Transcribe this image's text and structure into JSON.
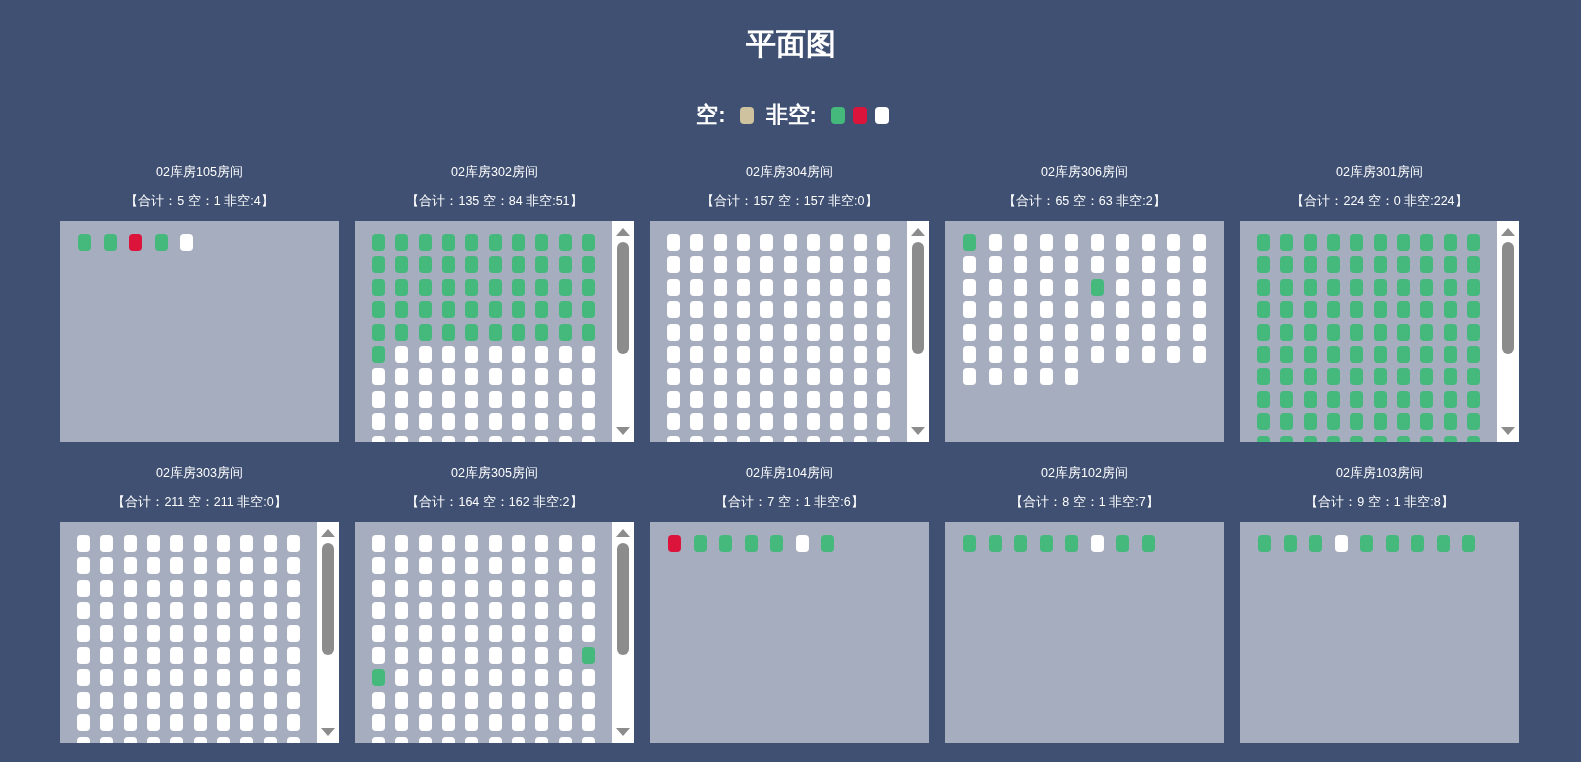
{
  "title": "平面图",
  "legend": [
    {
      "label": "空:",
      "swatches": [
        {
          "color": "#cfc29f"
        }
      ]
    },
    {
      "label": "非空:",
      "swatches": [
        {
          "color": "#45b97c"
        },
        {
          "color": "#dc143c"
        },
        {
          "color": "#ffffff"
        }
      ]
    }
  ],
  "rooms": [
    {
      "name": "02库房105房间",
      "summary": "【合计：5 空：1 非空:4】",
      "scrollable": false,
      "rows": [
        [
          {
            "color": "#45b97c"
          },
          {
            "color": "#45b97c"
          },
          {
            "color": "#dc143c"
          },
          {
            "color": "#45b97c"
          },
          {
            "color": "#ffffff"
          }
        ]
      ]
    },
    {
      "name": "02库房302房间",
      "summary": "【合计：135 空：84 非空:51】",
      "scrollable": true,
      "rows": [
        [
          {
            "color": "#45b97c"
          },
          {
            "color": "#45b97c"
          },
          {
            "color": "#45b97c"
          },
          {
            "color": "#45b97c"
          },
          {
            "color": "#45b97c"
          },
          {
            "color": "#45b97c"
          },
          {
            "color": "#45b97c"
          },
          {
            "color": "#45b97c"
          },
          {
            "color": "#45b97c"
          },
          {
            "color": "#45b97c"
          }
        ],
        [
          {
            "color": "#45b97c"
          },
          {
            "color": "#45b97c"
          },
          {
            "color": "#45b97c"
          },
          {
            "color": "#45b97c"
          },
          {
            "color": "#45b97c"
          },
          {
            "color": "#45b97c"
          },
          {
            "color": "#45b97c"
          },
          {
            "color": "#45b97c"
          },
          {
            "color": "#45b97c"
          },
          {
            "color": "#45b97c"
          }
        ],
        [
          {
            "color": "#45b97c"
          },
          {
            "color": "#45b97c"
          },
          {
            "color": "#45b97c"
          },
          {
            "color": "#45b97c"
          },
          {
            "color": "#45b97c"
          },
          {
            "color": "#45b97c"
          },
          {
            "color": "#45b97c"
          },
          {
            "color": "#45b97c"
          },
          {
            "color": "#45b97c"
          },
          {
            "color": "#45b97c"
          }
        ],
        [
          {
            "color": "#45b97c"
          },
          {
            "color": "#45b97c"
          },
          {
            "color": "#45b97c"
          },
          {
            "color": "#45b97c"
          },
          {
            "color": "#45b97c"
          },
          {
            "color": "#45b97c"
          },
          {
            "color": "#45b97c"
          },
          {
            "color": "#45b97c"
          },
          {
            "color": "#45b97c"
          },
          {
            "color": "#45b97c"
          }
        ],
        [
          {
            "color": "#45b97c"
          },
          {
            "color": "#45b97c"
          },
          {
            "color": "#45b97c"
          },
          {
            "color": "#45b97c"
          },
          {
            "color": "#45b97c"
          },
          {
            "color": "#45b97c"
          },
          {
            "color": "#45b97c"
          },
          {
            "color": "#45b97c"
          },
          {
            "color": "#45b97c"
          },
          {
            "color": "#45b97c"
          }
        ],
        [
          {
            "color": "#45b97c"
          },
          {
            "color": "#ffffff"
          },
          {
            "color": "#ffffff"
          },
          {
            "color": "#ffffff"
          },
          {
            "color": "#ffffff"
          },
          {
            "color": "#ffffff"
          },
          {
            "color": "#ffffff"
          },
          {
            "color": "#ffffff"
          },
          {
            "color": "#ffffff"
          },
          {
            "color": "#ffffff"
          }
        ],
        [
          {
            "color": "#ffffff"
          },
          {
            "color": "#ffffff"
          },
          {
            "color": "#ffffff"
          },
          {
            "color": "#ffffff"
          },
          {
            "color": "#ffffff"
          },
          {
            "color": "#ffffff"
          },
          {
            "color": "#ffffff"
          },
          {
            "color": "#ffffff"
          },
          {
            "color": "#ffffff"
          },
          {
            "color": "#ffffff"
          }
        ],
        [
          {
            "color": "#ffffff"
          },
          {
            "color": "#ffffff"
          },
          {
            "color": "#ffffff"
          },
          {
            "color": "#ffffff"
          },
          {
            "color": "#ffffff"
          },
          {
            "color": "#ffffff"
          },
          {
            "color": "#ffffff"
          },
          {
            "color": "#ffffff"
          },
          {
            "color": "#ffffff"
          },
          {
            "color": "#ffffff"
          }
        ],
        [
          {
            "color": "#ffffff"
          },
          {
            "color": "#ffffff"
          },
          {
            "color": "#ffffff"
          },
          {
            "color": "#ffffff"
          },
          {
            "color": "#ffffff"
          },
          {
            "color": "#ffffff"
          },
          {
            "color": "#ffffff"
          },
          {
            "color": "#ffffff"
          },
          {
            "color": "#ffffff"
          },
          {
            "color": "#ffffff"
          }
        ],
        [
          {
            "color": "#ffffff"
          },
          {
            "color": "#ffffff"
          },
          {
            "color": "#ffffff"
          },
          {
            "color": "#ffffff"
          },
          {
            "color": "#ffffff"
          },
          {
            "color": "#ffffff"
          },
          {
            "color": "#ffffff"
          },
          {
            "color": "#ffffff"
          },
          {
            "color": "#ffffff"
          },
          {
            "color": "#ffffff"
          }
        ]
      ]
    },
    {
      "name": "02库房304房间",
      "summary": "【合计：157 空：157 非空:0】",
      "scrollable": true,
      "rows": [
        [
          {
            "color": "#ffffff"
          },
          {
            "color": "#ffffff"
          },
          {
            "color": "#ffffff"
          },
          {
            "color": "#ffffff"
          },
          {
            "color": "#ffffff"
          },
          {
            "color": "#ffffff"
          },
          {
            "color": "#ffffff"
          },
          {
            "color": "#ffffff"
          },
          {
            "color": "#ffffff"
          },
          {
            "color": "#ffffff"
          }
        ],
        [
          {
            "color": "#ffffff"
          },
          {
            "color": "#ffffff"
          },
          {
            "color": "#ffffff"
          },
          {
            "color": "#ffffff"
          },
          {
            "color": "#ffffff"
          },
          {
            "color": "#ffffff"
          },
          {
            "color": "#ffffff"
          },
          {
            "color": "#ffffff"
          },
          {
            "color": "#ffffff"
          },
          {
            "color": "#ffffff"
          }
        ],
        [
          {
            "color": "#ffffff"
          },
          {
            "color": "#ffffff"
          },
          {
            "color": "#ffffff"
          },
          {
            "color": "#ffffff"
          },
          {
            "color": "#ffffff"
          },
          {
            "color": "#ffffff"
          },
          {
            "color": "#ffffff"
          },
          {
            "color": "#ffffff"
          },
          {
            "color": "#ffffff"
          },
          {
            "color": "#ffffff"
          }
        ],
        [
          {
            "color": "#ffffff"
          },
          {
            "color": "#ffffff"
          },
          {
            "color": "#ffffff"
          },
          {
            "color": "#ffffff"
          },
          {
            "color": "#ffffff"
          },
          {
            "color": "#ffffff"
          },
          {
            "color": "#ffffff"
          },
          {
            "color": "#ffffff"
          },
          {
            "color": "#ffffff"
          },
          {
            "color": "#ffffff"
          }
        ],
        [
          {
            "color": "#ffffff"
          },
          {
            "color": "#ffffff"
          },
          {
            "color": "#ffffff"
          },
          {
            "color": "#ffffff"
          },
          {
            "color": "#ffffff"
          },
          {
            "color": "#ffffff"
          },
          {
            "color": "#ffffff"
          },
          {
            "color": "#ffffff"
          },
          {
            "color": "#ffffff"
          },
          {
            "color": "#ffffff"
          }
        ],
        [
          {
            "color": "#ffffff"
          },
          {
            "color": "#ffffff"
          },
          {
            "color": "#ffffff"
          },
          {
            "color": "#ffffff"
          },
          {
            "color": "#ffffff"
          },
          {
            "color": "#ffffff"
          },
          {
            "color": "#ffffff"
          },
          {
            "color": "#ffffff"
          },
          {
            "color": "#ffffff"
          },
          {
            "color": "#ffffff"
          }
        ],
        [
          {
            "color": "#ffffff"
          },
          {
            "color": "#ffffff"
          },
          {
            "color": "#ffffff"
          },
          {
            "color": "#ffffff"
          },
          {
            "color": "#ffffff"
          },
          {
            "color": "#ffffff"
          },
          {
            "color": "#ffffff"
          },
          {
            "color": "#ffffff"
          },
          {
            "color": "#ffffff"
          },
          {
            "color": "#ffffff"
          }
        ],
        [
          {
            "color": "#ffffff"
          },
          {
            "color": "#ffffff"
          },
          {
            "color": "#ffffff"
          },
          {
            "color": "#ffffff"
          },
          {
            "color": "#ffffff"
          },
          {
            "color": "#ffffff"
          },
          {
            "color": "#ffffff"
          },
          {
            "color": "#ffffff"
          },
          {
            "color": "#ffffff"
          },
          {
            "color": "#ffffff"
          }
        ],
        [
          {
            "color": "#ffffff"
          },
          {
            "color": "#ffffff"
          },
          {
            "color": "#ffffff"
          },
          {
            "color": "#ffffff"
          },
          {
            "color": "#ffffff"
          },
          {
            "color": "#ffffff"
          },
          {
            "color": "#ffffff"
          },
          {
            "color": "#ffffff"
          },
          {
            "color": "#ffffff"
          },
          {
            "color": "#ffffff"
          }
        ],
        [
          {
            "color": "#ffffff"
          },
          {
            "color": "#ffffff"
          },
          {
            "color": "#ffffff"
          },
          {
            "color": "#ffffff"
          },
          {
            "color": "#ffffff"
          },
          {
            "color": "#ffffff"
          },
          {
            "color": "#ffffff"
          },
          {
            "color": "#ffffff"
          },
          {
            "color": "#ffffff"
          },
          {
            "color": "#ffffff"
          }
        ]
      ]
    },
    {
      "name": "02库房306房间",
      "summary": "【合计：65 空：63 非空:2】",
      "scrollable": false,
      "rows": [
        [
          {
            "color": "#45b97c"
          },
          {
            "color": "#ffffff"
          },
          {
            "color": "#ffffff"
          },
          {
            "color": "#ffffff"
          },
          {
            "color": "#ffffff"
          },
          {
            "color": "#ffffff"
          },
          {
            "color": "#ffffff"
          },
          {
            "color": "#ffffff"
          },
          {
            "color": "#ffffff"
          },
          {
            "color": "#ffffff"
          }
        ],
        [
          {
            "color": "#ffffff"
          },
          {
            "color": "#ffffff"
          },
          {
            "color": "#ffffff"
          },
          {
            "color": "#ffffff"
          },
          {
            "color": "#ffffff"
          },
          {
            "color": "#ffffff"
          },
          {
            "color": "#ffffff"
          },
          {
            "color": "#ffffff"
          },
          {
            "color": "#ffffff"
          },
          {
            "color": "#ffffff"
          }
        ],
        [
          {
            "color": "#ffffff"
          },
          {
            "color": "#ffffff"
          },
          {
            "color": "#ffffff"
          },
          {
            "color": "#ffffff"
          },
          {
            "color": "#ffffff"
          },
          {
            "color": "#45b97c"
          },
          {
            "color": "#ffffff"
          },
          {
            "color": "#ffffff"
          },
          {
            "color": "#ffffff"
          },
          {
            "color": "#ffffff"
          }
        ],
        [
          {
            "color": "#ffffff"
          },
          {
            "color": "#ffffff"
          },
          {
            "color": "#ffffff"
          },
          {
            "color": "#ffffff"
          },
          {
            "color": "#ffffff"
          },
          {
            "color": "#ffffff"
          },
          {
            "color": "#ffffff"
          },
          {
            "color": "#ffffff"
          },
          {
            "color": "#ffffff"
          },
          {
            "color": "#ffffff"
          }
        ],
        [
          {
            "color": "#ffffff"
          },
          {
            "color": "#ffffff"
          },
          {
            "color": "#ffffff"
          },
          {
            "color": "#ffffff"
          },
          {
            "color": "#ffffff"
          },
          {
            "color": "#ffffff"
          },
          {
            "color": "#ffffff"
          },
          {
            "color": "#ffffff"
          },
          {
            "color": "#ffffff"
          },
          {
            "color": "#ffffff"
          }
        ],
        [
          {
            "color": "#ffffff"
          },
          {
            "color": "#ffffff"
          },
          {
            "color": "#ffffff"
          },
          {
            "color": "#ffffff"
          },
          {
            "color": "#ffffff"
          },
          {
            "color": "#ffffff"
          },
          {
            "color": "#ffffff"
          },
          {
            "color": "#ffffff"
          },
          {
            "color": "#ffffff"
          },
          {
            "color": "#ffffff"
          }
        ],
        [
          {
            "color": "#ffffff"
          },
          {
            "color": "#ffffff"
          },
          {
            "color": "#ffffff"
          },
          {
            "color": "#ffffff"
          },
          {
            "color": "#ffffff"
          }
        ]
      ]
    },
    {
      "name": "02库房301房间",
      "summary": "【合计：224 空：0 非空:224】",
      "scrollable": true,
      "rows": [
        [
          {
            "color": "#45b97c"
          },
          {
            "color": "#45b97c"
          },
          {
            "color": "#45b97c"
          },
          {
            "color": "#45b97c"
          },
          {
            "color": "#45b97c"
          },
          {
            "color": "#45b97c"
          },
          {
            "color": "#45b97c"
          },
          {
            "color": "#45b97c"
          },
          {
            "color": "#45b97c"
          },
          {
            "color": "#45b97c"
          }
        ],
        [
          {
            "color": "#45b97c"
          },
          {
            "color": "#45b97c"
          },
          {
            "color": "#45b97c"
          },
          {
            "color": "#45b97c"
          },
          {
            "color": "#45b97c"
          },
          {
            "color": "#45b97c"
          },
          {
            "color": "#45b97c"
          },
          {
            "color": "#45b97c"
          },
          {
            "color": "#45b97c"
          },
          {
            "color": "#45b97c"
          }
        ],
        [
          {
            "color": "#45b97c"
          },
          {
            "color": "#45b97c"
          },
          {
            "color": "#45b97c"
          },
          {
            "color": "#45b97c"
          },
          {
            "color": "#45b97c"
          },
          {
            "color": "#45b97c"
          },
          {
            "color": "#45b97c"
          },
          {
            "color": "#45b97c"
          },
          {
            "color": "#45b97c"
          },
          {
            "color": "#45b97c"
          }
        ],
        [
          {
            "color": "#45b97c"
          },
          {
            "color": "#45b97c"
          },
          {
            "color": "#45b97c"
          },
          {
            "color": "#45b97c"
          },
          {
            "color": "#45b97c"
          },
          {
            "color": "#45b97c"
          },
          {
            "color": "#45b97c"
          },
          {
            "color": "#45b97c"
          },
          {
            "color": "#45b97c"
          },
          {
            "color": "#45b97c"
          }
        ],
        [
          {
            "color": "#45b97c"
          },
          {
            "color": "#45b97c"
          },
          {
            "color": "#45b97c"
          },
          {
            "color": "#45b97c"
          },
          {
            "color": "#45b97c"
          },
          {
            "color": "#45b97c"
          },
          {
            "color": "#45b97c"
          },
          {
            "color": "#45b97c"
          },
          {
            "color": "#45b97c"
          },
          {
            "color": "#45b97c"
          }
        ],
        [
          {
            "color": "#45b97c"
          },
          {
            "color": "#45b97c"
          },
          {
            "color": "#45b97c"
          },
          {
            "color": "#45b97c"
          },
          {
            "color": "#45b97c"
          },
          {
            "color": "#45b97c"
          },
          {
            "color": "#45b97c"
          },
          {
            "color": "#45b97c"
          },
          {
            "color": "#45b97c"
          },
          {
            "color": "#45b97c"
          }
        ],
        [
          {
            "color": "#45b97c"
          },
          {
            "color": "#45b97c"
          },
          {
            "color": "#45b97c"
          },
          {
            "color": "#45b97c"
          },
          {
            "color": "#45b97c"
          },
          {
            "color": "#45b97c"
          },
          {
            "color": "#45b97c"
          },
          {
            "color": "#45b97c"
          },
          {
            "color": "#45b97c"
          },
          {
            "color": "#45b97c"
          }
        ],
        [
          {
            "color": "#45b97c"
          },
          {
            "color": "#45b97c"
          },
          {
            "color": "#45b97c"
          },
          {
            "color": "#45b97c"
          },
          {
            "color": "#45b97c"
          },
          {
            "color": "#45b97c"
          },
          {
            "color": "#45b97c"
          },
          {
            "color": "#45b97c"
          },
          {
            "color": "#45b97c"
          },
          {
            "color": "#45b97c"
          }
        ],
        [
          {
            "color": "#45b97c"
          },
          {
            "color": "#45b97c"
          },
          {
            "color": "#45b97c"
          },
          {
            "color": "#45b97c"
          },
          {
            "color": "#45b97c"
          },
          {
            "color": "#45b97c"
          },
          {
            "color": "#45b97c"
          },
          {
            "color": "#45b97c"
          },
          {
            "color": "#45b97c"
          },
          {
            "color": "#45b97c"
          }
        ],
        [
          {
            "color": "#45b97c"
          },
          {
            "color": "#45b97c"
          },
          {
            "color": "#45b97c"
          },
          {
            "color": "#45b97c"
          },
          {
            "color": "#45b97c"
          },
          {
            "color": "#45b97c"
          },
          {
            "color": "#45b97c"
          },
          {
            "color": "#45b97c"
          },
          {
            "color": "#45b97c"
          },
          {
            "color": "#45b97c"
          }
        ]
      ]
    },
    {
      "name": "02库房303房间",
      "summary": "【合计：211 空：211 非空:0】",
      "scrollable": true,
      "rows": [
        [
          {
            "color": "#ffffff"
          },
          {
            "color": "#ffffff"
          },
          {
            "color": "#ffffff"
          },
          {
            "color": "#ffffff"
          },
          {
            "color": "#ffffff"
          },
          {
            "color": "#ffffff"
          },
          {
            "color": "#ffffff"
          },
          {
            "color": "#ffffff"
          },
          {
            "color": "#ffffff"
          },
          {
            "color": "#ffffff"
          }
        ],
        [
          {
            "color": "#ffffff"
          },
          {
            "color": "#ffffff"
          },
          {
            "color": "#ffffff"
          },
          {
            "color": "#ffffff"
          },
          {
            "color": "#ffffff"
          },
          {
            "color": "#ffffff"
          },
          {
            "color": "#ffffff"
          },
          {
            "color": "#ffffff"
          },
          {
            "color": "#ffffff"
          },
          {
            "color": "#ffffff"
          }
        ],
        [
          {
            "color": "#ffffff"
          },
          {
            "color": "#ffffff"
          },
          {
            "color": "#ffffff"
          },
          {
            "color": "#ffffff"
          },
          {
            "color": "#ffffff"
          },
          {
            "color": "#ffffff"
          },
          {
            "color": "#ffffff"
          },
          {
            "color": "#ffffff"
          },
          {
            "color": "#ffffff"
          },
          {
            "color": "#ffffff"
          }
        ],
        [
          {
            "color": "#ffffff"
          },
          {
            "color": "#ffffff"
          },
          {
            "color": "#ffffff"
          },
          {
            "color": "#ffffff"
          },
          {
            "color": "#ffffff"
          },
          {
            "color": "#ffffff"
          },
          {
            "color": "#ffffff"
          },
          {
            "color": "#ffffff"
          },
          {
            "color": "#ffffff"
          },
          {
            "color": "#ffffff"
          }
        ],
        [
          {
            "color": "#ffffff"
          },
          {
            "color": "#ffffff"
          },
          {
            "color": "#ffffff"
          },
          {
            "color": "#ffffff"
          },
          {
            "color": "#ffffff"
          },
          {
            "color": "#ffffff"
          },
          {
            "color": "#ffffff"
          },
          {
            "color": "#ffffff"
          },
          {
            "color": "#ffffff"
          },
          {
            "color": "#ffffff"
          }
        ],
        [
          {
            "color": "#ffffff"
          },
          {
            "color": "#ffffff"
          },
          {
            "color": "#ffffff"
          },
          {
            "color": "#ffffff"
          },
          {
            "color": "#ffffff"
          },
          {
            "color": "#ffffff"
          },
          {
            "color": "#ffffff"
          },
          {
            "color": "#ffffff"
          },
          {
            "color": "#ffffff"
          },
          {
            "color": "#ffffff"
          }
        ],
        [
          {
            "color": "#ffffff"
          },
          {
            "color": "#ffffff"
          },
          {
            "color": "#ffffff"
          },
          {
            "color": "#ffffff"
          },
          {
            "color": "#ffffff"
          },
          {
            "color": "#ffffff"
          },
          {
            "color": "#ffffff"
          },
          {
            "color": "#ffffff"
          },
          {
            "color": "#ffffff"
          },
          {
            "color": "#ffffff"
          }
        ],
        [
          {
            "color": "#ffffff"
          },
          {
            "color": "#ffffff"
          },
          {
            "color": "#ffffff"
          },
          {
            "color": "#ffffff"
          },
          {
            "color": "#ffffff"
          },
          {
            "color": "#ffffff"
          },
          {
            "color": "#ffffff"
          },
          {
            "color": "#ffffff"
          },
          {
            "color": "#ffffff"
          },
          {
            "color": "#ffffff"
          }
        ],
        [
          {
            "color": "#ffffff"
          },
          {
            "color": "#ffffff"
          },
          {
            "color": "#ffffff"
          },
          {
            "color": "#ffffff"
          },
          {
            "color": "#ffffff"
          },
          {
            "color": "#ffffff"
          },
          {
            "color": "#ffffff"
          },
          {
            "color": "#ffffff"
          },
          {
            "color": "#ffffff"
          },
          {
            "color": "#ffffff"
          }
        ],
        [
          {
            "color": "#ffffff"
          },
          {
            "color": "#ffffff"
          },
          {
            "color": "#ffffff"
          },
          {
            "color": "#ffffff"
          },
          {
            "color": "#ffffff"
          },
          {
            "color": "#ffffff"
          },
          {
            "color": "#ffffff"
          },
          {
            "color": "#ffffff"
          },
          {
            "color": "#ffffff"
          },
          {
            "color": "#ffffff"
          }
        ]
      ]
    },
    {
      "name": "02库房305房间",
      "summary": "【合计：164 空：162 非空:2】",
      "scrollable": true,
      "rows": [
        [
          {
            "color": "#ffffff"
          },
          {
            "color": "#ffffff"
          },
          {
            "color": "#ffffff"
          },
          {
            "color": "#ffffff"
          },
          {
            "color": "#ffffff"
          },
          {
            "color": "#ffffff"
          },
          {
            "color": "#ffffff"
          },
          {
            "color": "#ffffff"
          },
          {
            "color": "#ffffff"
          },
          {
            "color": "#ffffff"
          }
        ],
        [
          {
            "color": "#ffffff"
          },
          {
            "color": "#ffffff"
          },
          {
            "color": "#ffffff"
          },
          {
            "color": "#ffffff"
          },
          {
            "color": "#ffffff"
          },
          {
            "color": "#ffffff"
          },
          {
            "color": "#ffffff"
          },
          {
            "color": "#ffffff"
          },
          {
            "color": "#ffffff"
          },
          {
            "color": "#ffffff"
          }
        ],
        [
          {
            "color": "#ffffff"
          },
          {
            "color": "#ffffff"
          },
          {
            "color": "#ffffff"
          },
          {
            "color": "#ffffff"
          },
          {
            "color": "#ffffff"
          },
          {
            "color": "#ffffff"
          },
          {
            "color": "#ffffff"
          },
          {
            "color": "#ffffff"
          },
          {
            "color": "#ffffff"
          },
          {
            "color": "#ffffff"
          }
        ],
        [
          {
            "color": "#ffffff"
          },
          {
            "color": "#ffffff"
          },
          {
            "color": "#ffffff"
          },
          {
            "color": "#ffffff"
          },
          {
            "color": "#ffffff"
          },
          {
            "color": "#ffffff"
          },
          {
            "color": "#ffffff"
          },
          {
            "color": "#ffffff"
          },
          {
            "color": "#ffffff"
          },
          {
            "color": "#ffffff"
          }
        ],
        [
          {
            "color": "#ffffff"
          },
          {
            "color": "#ffffff"
          },
          {
            "color": "#ffffff"
          },
          {
            "color": "#ffffff"
          },
          {
            "color": "#ffffff"
          },
          {
            "color": "#ffffff"
          },
          {
            "color": "#ffffff"
          },
          {
            "color": "#ffffff"
          },
          {
            "color": "#ffffff"
          },
          {
            "color": "#ffffff"
          }
        ],
        [
          {
            "color": "#ffffff"
          },
          {
            "color": "#ffffff"
          },
          {
            "color": "#ffffff"
          },
          {
            "color": "#ffffff"
          },
          {
            "color": "#ffffff"
          },
          {
            "color": "#ffffff"
          },
          {
            "color": "#ffffff"
          },
          {
            "color": "#ffffff"
          },
          {
            "color": "#ffffff"
          },
          {
            "color": "#45b97c"
          }
        ],
        [
          {
            "color": "#45b97c"
          },
          {
            "color": "#ffffff"
          },
          {
            "color": "#ffffff"
          },
          {
            "color": "#ffffff"
          },
          {
            "color": "#ffffff"
          },
          {
            "color": "#ffffff"
          },
          {
            "color": "#ffffff"
          },
          {
            "color": "#ffffff"
          },
          {
            "color": "#ffffff"
          },
          {
            "color": "#ffffff"
          }
        ],
        [
          {
            "color": "#ffffff"
          },
          {
            "color": "#ffffff"
          },
          {
            "color": "#ffffff"
          },
          {
            "color": "#ffffff"
          },
          {
            "color": "#ffffff"
          },
          {
            "color": "#ffffff"
          },
          {
            "color": "#ffffff"
          },
          {
            "color": "#ffffff"
          },
          {
            "color": "#ffffff"
          },
          {
            "color": "#ffffff"
          }
        ],
        [
          {
            "color": "#ffffff"
          },
          {
            "color": "#ffffff"
          },
          {
            "color": "#ffffff"
          },
          {
            "color": "#ffffff"
          },
          {
            "color": "#ffffff"
          },
          {
            "color": "#ffffff"
          },
          {
            "color": "#ffffff"
          },
          {
            "color": "#ffffff"
          },
          {
            "color": "#ffffff"
          },
          {
            "color": "#ffffff"
          }
        ],
        [
          {
            "color": "#ffffff"
          },
          {
            "color": "#ffffff"
          },
          {
            "color": "#ffffff"
          },
          {
            "color": "#ffffff"
          },
          {
            "color": "#ffffff"
          },
          {
            "color": "#ffffff"
          },
          {
            "color": "#ffffff"
          },
          {
            "color": "#ffffff"
          },
          {
            "color": "#ffffff"
          },
          {
            "color": "#ffffff"
          }
        ]
      ]
    },
    {
      "name": "02库房104房间",
      "summary": "【合计：7 空：1 非空:6】",
      "scrollable": false,
      "rows": [
        [
          {
            "color": "#dc143c"
          },
          {
            "color": "#45b97c"
          },
          {
            "color": "#45b97c"
          },
          {
            "color": "#45b97c"
          },
          {
            "color": "#45b97c"
          },
          {
            "color": "#ffffff"
          },
          {
            "color": "#45b97c"
          }
        ]
      ]
    },
    {
      "name": "02库房102房间",
      "summary": "【合计：8 空：1 非空:7】",
      "scrollable": false,
      "rows": [
        [
          {
            "color": "#45b97c"
          },
          {
            "color": "#45b97c"
          },
          {
            "color": "#45b97c"
          },
          {
            "color": "#45b97c"
          },
          {
            "color": "#45b97c"
          },
          {
            "color": "#ffffff"
          },
          {
            "color": "#45b97c"
          },
          {
            "color": "#45b97c"
          }
        ]
      ]
    },
    {
      "name": "02库房103房间",
      "summary": "【合计：9 空：1 非空:8】",
      "scrollable": false,
      "rows": [
        [
          {
            "color": "#45b97c"
          },
          {
            "color": "#45b97c"
          },
          {
            "color": "#45b97c"
          },
          {
            "color": "#ffffff"
          },
          {
            "color": "#45b97c"
          },
          {
            "color": "#45b97c"
          },
          {
            "color": "#45b97c"
          },
          {
            "color": "#45b97c"
          },
          {
            "color": "#45b97c"
          }
        ]
      ]
    }
  ]
}
